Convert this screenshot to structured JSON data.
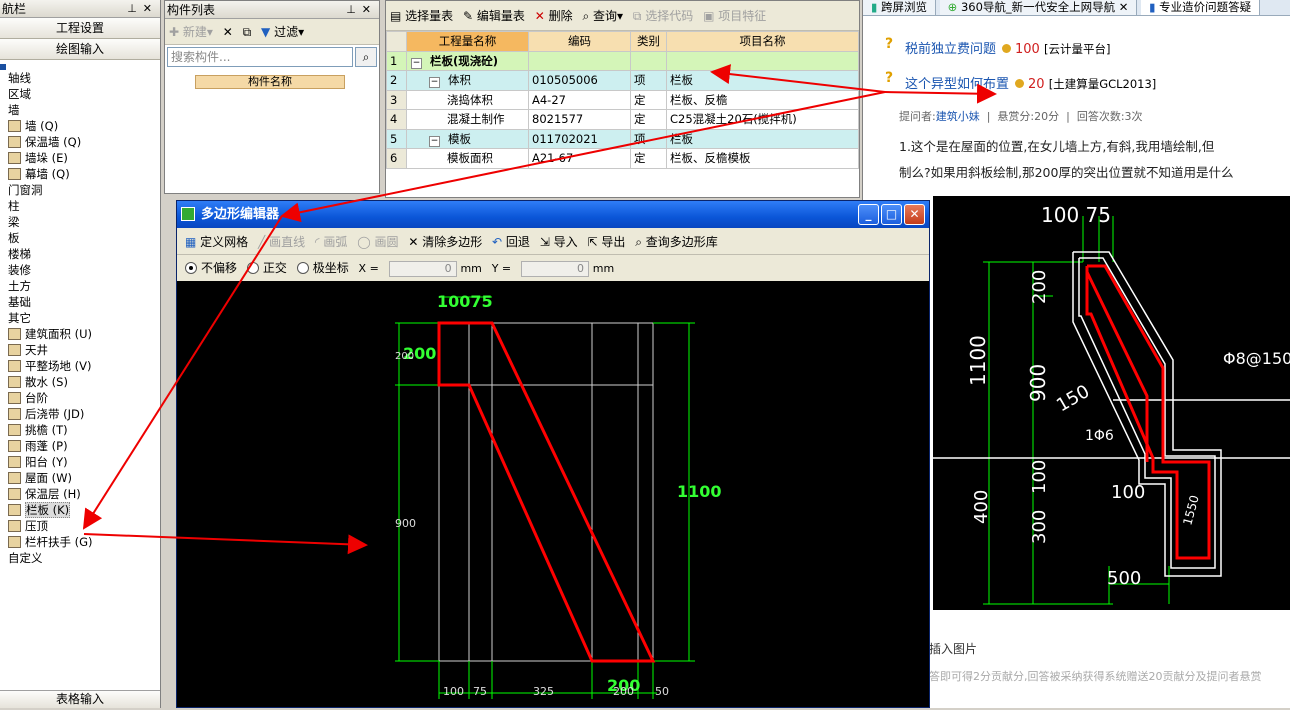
{
  "nav": {
    "title": "航栏",
    "btn_project_settings": "工程设置",
    "btn_drawing_input": "绘图输入",
    "bottom_tab": "表格输入",
    "tree": [
      {
        "label": "轴线",
        "level": 0
      },
      {
        "label": "区域",
        "level": 0
      },
      {
        "label": "墙",
        "level": 0
      },
      {
        "label": "墙 (Q)",
        "level": 1
      },
      {
        "label": "保温墙 (Q)",
        "level": 1
      },
      {
        "label": "墙垛 (E)",
        "level": 1
      },
      {
        "label": "幕墙 (Q)",
        "level": 1
      },
      {
        "label": "门窗洞",
        "level": 0
      },
      {
        "label": "柱",
        "level": 0
      },
      {
        "label": "梁",
        "level": 0
      },
      {
        "label": "板",
        "level": 0
      },
      {
        "label": "楼梯",
        "level": 0
      },
      {
        "label": "装修",
        "level": 0
      },
      {
        "label": "土方",
        "level": 0
      },
      {
        "label": "基础",
        "level": 0
      },
      {
        "label": "其它",
        "level": 0
      },
      {
        "label": "建筑面积 (U)",
        "level": 1
      },
      {
        "label": "天井",
        "level": 1
      },
      {
        "label": "平整场地 (V)",
        "level": 1
      },
      {
        "label": "散水 (S)",
        "level": 1
      },
      {
        "label": "台阶",
        "level": 1
      },
      {
        "label": "后浇带 (JD)",
        "level": 1
      },
      {
        "label": "挑檐 (T)",
        "level": 1
      },
      {
        "label": "雨蓬 (P)",
        "level": 1
      },
      {
        "label": "阳台 (Y)",
        "level": 1
      },
      {
        "label": "屋面 (W)",
        "level": 1
      },
      {
        "label": "保温层 (H)",
        "level": 1
      },
      {
        "label": "栏板 (K)",
        "level": 1,
        "selected": true
      },
      {
        "label": "压顶",
        "level": 1
      },
      {
        "label": "栏杆扶手 (G)",
        "level": 1
      },
      {
        "label": "自定义",
        "level": 0
      }
    ]
  },
  "components": {
    "title": "构件列表",
    "new_label": "新建",
    "filter_label": "过滤",
    "search_placeholder": "搜索构件...",
    "column_header": "构件名称"
  },
  "quantities": {
    "toolbar": {
      "select": "选择量表",
      "edit": "编辑量表",
      "delete": "删除",
      "query": "查询",
      "select_code": "选择代码",
      "item_feature": "项目特征"
    },
    "headers": [
      "工程量名称",
      "编码",
      "类别",
      "项目名称"
    ],
    "rows": [
      {
        "n": "1",
        "name": "栏板(现浇砼)",
        "code": "",
        "type": "",
        "item": ""
      },
      {
        "n": "2",
        "name": "体积",
        "code": "010505006",
        "type": "项",
        "item": "栏板"
      },
      {
        "n": "3",
        "name": "浇捣体积",
        "code": "A4-27",
        "type": "定",
        "item": "栏板、反檐"
      },
      {
        "n": "4",
        "name": "混凝土制作",
        "code": "8021577",
        "type": "定",
        "item": "C25混凝土20石(搅拌机)"
      },
      {
        "n": "5",
        "name": "模板",
        "code": "011702021",
        "type": "项",
        "item": "栏板"
      },
      {
        "n": "6",
        "name": "模板面积",
        "code": "A21-67",
        "type": "定",
        "item": "栏板、反檐模板"
      }
    ]
  },
  "browser": {
    "tabs": [
      "跨屏浏览",
      "360导航_新一代安全上网导航",
      "专业造价问题答疑"
    ],
    "q1": {
      "title": "税前独立费问题",
      "points": "100",
      "tag": "[云计量平台]"
    },
    "q2": {
      "title": "这个异型如何布置",
      "points": "20",
      "tag": "[土建算量GCL2013]"
    },
    "meta": {
      "asker_label": "提问者:",
      "asker": "建筑小妹",
      "bounty": "悬赏分:20分",
      "answers": "回答次数:3次"
    },
    "body_line1": "1.这个是在屋面的位置,在女儿墙上方,有斜,我用墙绘制,但",
    "body_line2": "制么?如果用斜板绘制,那200厚的突出位置就不知道用是什么",
    "insert_image": "插入图片",
    "bottom_note": "答即可得2分贡献分,回答被采纳获得系统赠送20贡献分及提问者悬赏",
    "cad": {
      "top_dims": "100 75",
      "d200": "200",
      "d1100": "1100",
      "d900": "900",
      "d150": "150",
      "rebar": "Φ8@150双",
      "d1_6": "1Φ6",
      "d100": "100",
      "d100b": "100",
      "d300": "300",
      "d400": "400",
      "d500": "500",
      "d1550": "1550"
    }
  },
  "poly": {
    "title": "多边形编辑器",
    "toolbar1": {
      "define_grid": "定义网格",
      "draw_line": "画直线",
      "draw_arc": "画弧",
      "draw_circle": "画圆",
      "clear_polygon": "清除多边形",
      "undo": "回退",
      "import": "导入",
      "export": "导出",
      "query_lib": "查询多边形库"
    },
    "toolbar2": {
      "no_offset": "不偏移",
      "orthogonal": "正交",
      "polar": "极坐标",
      "x_label": "X =",
      "x_value": "0",
      "y_label": "Y =",
      "y_value": "0",
      "unit": "mm"
    },
    "canvas": {
      "top_label": "10075",
      "left_label": "200",
      "left_small": "200",
      "right_label": "1100",
      "left_900": "900",
      "bottom_green": "200",
      "bottom_dims": [
        "100",
        "75",
        "325",
        "200",
        "50"
      ]
    }
  }
}
